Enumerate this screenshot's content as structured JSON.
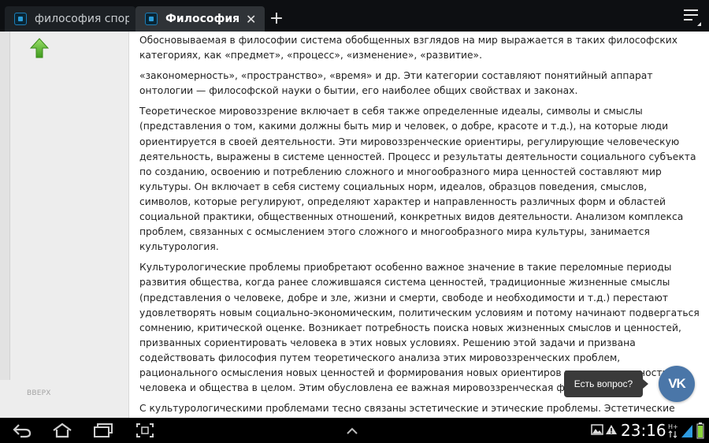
{
  "tabs": [
    {
      "title": "философия спор…",
      "active": false
    },
    {
      "title": "Философия…",
      "active": true
    }
  ],
  "toolbar": {
    "new_tab": "+",
    "close": "✕"
  },
  "sidebar": {
    "up_label": "ВВЕРХ"
  },
  "article": {
    "paragraphs": [
      "Обосновываемая в философии система обобщенных взглядов на мир выражается в таких философских категориях, как «предмет», «процесс», «изменение», «развитие».",
      "«закономерность», «пространство», «время» и др. Эти категории составляют понятийный аппарат онтологии — философской науки о бытии, его наиболее общих свойствах и законах.",
      "Теоретическое мировоззрение включает в себя также определенные идеалы, символы и смыслы (представления о том, какими должны быть мир и человек, о добре, красоте и т.д.), на которые люди ориентируется в своей деятельности. Эти мировоззренческие ориентиры, регулирующие человеческую деятельность, выражены в системе ценностей. Процесс и результаты деятельности социального субъекта по созданию, освоению и потреблению сложного и многообразного мира ценностей составляют мир культуры. Он включает в себя систему социальных норм, идеалов, образцов поведения, смыслов, символов, которые регулируют, определяют характер и направленность различных форм и областей социальной практики, общественных отношений, конкретных видов деятельности. Анализом комплекса проблем, связанных с осмыслением этого сложного и многообразного мира культуры, занимается культурология.",
      "Культурологические проблемы приобретают особенно важное значение в такие переломные периоды развития общества, когда ранее сложившаяся система ценностей, традиционные жизненные смыслы (представления о человеке, добре и зле, жизни и смерти, свободе и необходимости и т.д.) перестают удовлетворять новым социально-экономическим, политическим условиям и потому начинают подвергаться сомнению, критической оценке. Возникает потребность поиска новых жизненных смыслов и ценностей, призванных сориентировать человека в этих новых условиях. Решению этой задачи и призвана содействовать философия путем теоретического анализа этих мировоззренческих проблем, рационального осмысления новых ценностей и формирования новых ориентиров жизнедеятельности человека и общества в целом. Этим обусловлена ее важная мировоззренческая функция.",
      "С культурологическими проблемами тесно связаны эстетические и этические проблемы. Эстетические проблемы — это проблемы относительно эстетического отношения человека к миру на основе таких эстетических"
    ]
  },
  "widget": {
    "ask_label": "Есть вопрос?",
    "vk_label": "VK"
  },
  "status": {
    "time": "23:16"
  },
  "colors": {
    "vk": "#4a76a8",
    "arrow": "#5cb82e",
    "tabbar": "#0d0f12"
  }
}
